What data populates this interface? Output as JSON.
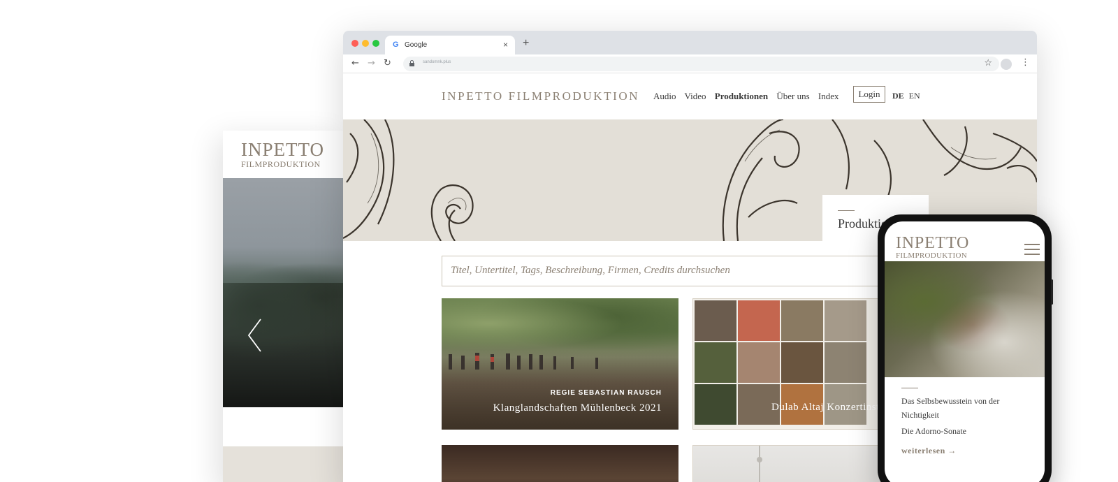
{
  "tablet": {
    "logo_line1": "INPETTO",
    "logo_line2": "FILMPRODUKTION",
    "prev_icon": "chevron-left-icon"
  },
  "browser": {
    "tab_title": "Google",
    "tab_icon": "google-g-icon",
    "url": "sandomnk.plus",
    "nav_icons": [
      "back-arrow-icon",
      "forward-arrow-icon",
      "reload-icon"
    ],
    "colors": {
      "close": "#fe5f57",
      "minimize": "#febc2e",
      "maximize": "#28c840"
    }
  },
  "site": {
    "logo": "INPETTO FILMPRODUKTION",
    "nav": [
      "Audio",
      "Video",
      "Produktionen",
      "Über uns",
      "Index"
    ],
    "active_nav": "Produktionen",
    "login": "Login",
    "lang_de": "DE",
    "lang_en": "EN",
    "hero_title": "Produktionen",
    "search_placeholder": "Titel, Untertitel, Tags, Beschreibung, Firmen, Credits durchsuchen",
    "cards": [
      {
        "subtitle": "REGIE SEBASTIAN RAUSCH",
        "title": "Klanglandschaften Mühlenbeck 2021"
      },
      {
        "subtitle": "",
        "title": "Dulab Altaj Konzertinstallation"
      }
    ]
  },
  "phone": {
    "logo_line1": "INPETTO",
    "logo_line2": "FILMPRODUKTION",
    "menu_icon": "hamburger-menu-icon",
    "card_title": "Das Selbsbewusstein von der Nichtigkeit",
    "card_subtitle": "Die Adorno-Sonate",
    "read_more": "weiterlesen →"
  },
  "accent": "#8a7f72"
}
